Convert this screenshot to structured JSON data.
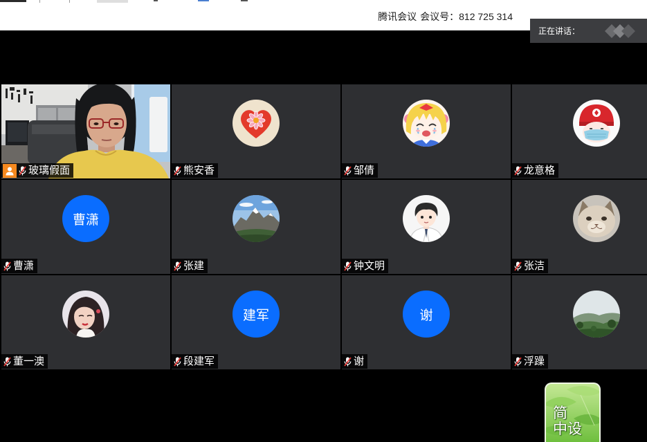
{
  "header": {
    "app_name": "腾讯会议",
    "meeting_id_label": "会议号：",
    "meeting_id": "812 725 314"
  },
  "speaking_panel": {
    "label": "正在讲话：",
    "icon": "tencent-meeting-logo-icon"
  },
  "participants": [
    {
      "name": "玻璃假面",
      "host": true,
      "host_icon": "person-icon",
      "mic": "muted"
    },
    {
      "name": "熊安香",
      "avatar_icon": "heart-flower-avatar",
      "mic": "muted"
    },
    {
      "name": "邹倩",
      "avatar_icon": "anime-girl-avatar",
      "mic": "muted"
    },
    {
      "name": "龙意格",
      "avatar_icon": "red-helmet-avatar",
      "mic": "muted"
    },
    {
      "name": "曹潇",
      "avatar_text": "曹潇",
      "avatar_color": "#0a6dff",
      "mic": "muted"
    },
    {
      "name": "张建",
      "avatar_icon": "mountain-avatar",
      "mic": "muted"
    },
    {
      "name": "钟文明",
      "avatar_icon": "cartoon-boy-avatar",
      "mic": "muted"
    },
    {
      "name": "张洁",
      "avatar_icon": "cat-avatar",
      "mic": "muted"
    },
    {
      "name": "董一澳",
      "avatar_icon": "woman-photo-avatar",
      "mic": "muted"
    },
    {
      "name": "段建军",
      "avatar_text": "建军",
      "avatar_color": "#0a6dff",
      "mic": "muted"
    },
    {
      "name": "谢",
      "avatar_text": "谢",
      "avatar_color": "#0a6dff",
      "mic": "muted"
    },
    {
      "name": "浮躁",
      "avatar_icon": "landscape-avatar",
      "mic": "muted"
    }
  ],
  "floating_shortcut": {
    "line1": "简",
    "line2": "中设",
    "icon": "green-leaf-app-icon"
  },
  "colors": {
    "stage_bg": "#000000",
    "tile_bg": "#2e2f32",
    "header_bg": "#ffffff",
    "speaking_panel_bg": "#3c3d40",
    "host_badge": "#f5891f",
    "mic_slash": "#e53935",
    "avatar_blue": "#0a6dff"
  }
}
